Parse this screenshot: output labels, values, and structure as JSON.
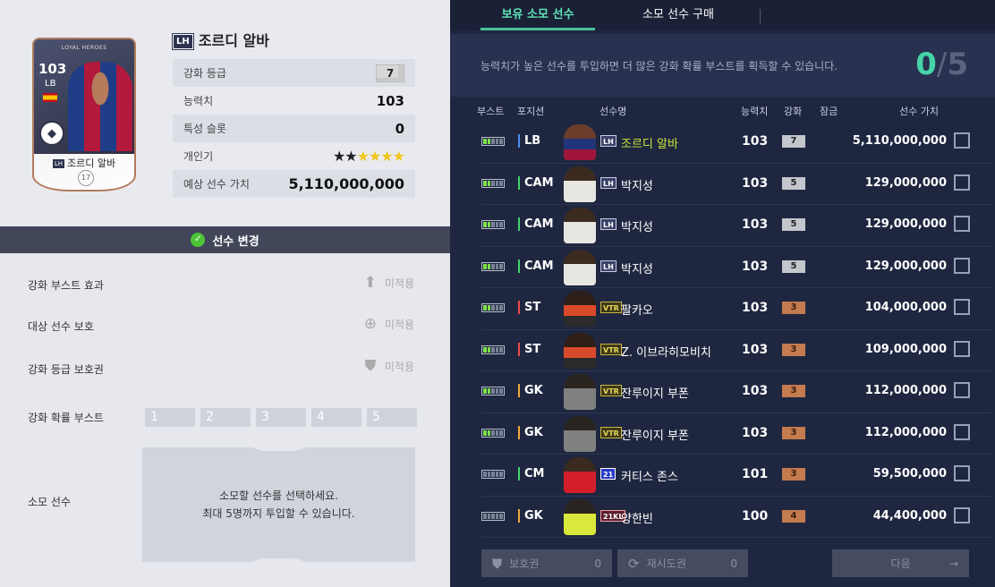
{
  "card": {
    "brand": "LOYAL HEROES",
    "ovr": "103",
    "pos": "LB",
    "season_tag": "LH",
    "name": "조르디 알바",
    "level": "7",
    "number": "17"
  },
  "player": {
    "season_tag": "LH",
    "name": "조르디 알바",
    "stats": [
      {
        "label": "강화 등급",
        "value": "7"
      },
      {
        "label": "능력치",
        "value": "103"
      },
      {
        "label": "특성 슬롯",
        "value": "0"
      },
      {
        "label": "개인기",
        "stars_filled": 2,
        "stars_total": 6
      },
      {
        "label": "예상 선수 가치",
        "value": "5,110,000,000"
      }
    ]
  },
  "change_player": {
    "label": "선수 변경"
  },
  "options": {
    "boost_effect": {
      "label": "강화 부스트 효과",
      "value": "미적용",
      "icon": "arrow-up-icon"
    },
    "protect": {
      "label": "대상 선수 보호",
      "value": "미적용",
      "icon": "plus-circle-icon"
    },
    "grade_protect": {
      "label": "강화 등급 보호권",
      "value": "미적용",
      "icon": "shield-icon"
    },
    "probability_boost": {
      "label": "강화 확률 부스트",
      "slots": [
        "1",
        "2",
        "3",
        "4",
        "5"
      ]
    },
    "sacrifice": {
      "label": "소모 선수",
      "line1": "소모할 선수를 선택하세요.",
      "line2": "최대 5명까지 투입할 수 있습니다."
    }
  },
  "tabs": [
    {
      "label": "보유 소모 선수",
      "active": true
    },
    {
      "label": "소모 선수 구매",
      "active": false
    }
  ],
  "info": {
    "text": "능력치가 높은 선수를 투입하면 더 많은 강화 확률 부스트를 획득할 수 있습니다.",
    "selected": "0",
    "max": "5"
  },
  "columns": {
    "boost": "부스트",
    "position": "포지션",
    "name": "선수명",
    "ovr": "능력치",
    "level": "강화",
    "locked": "잠금",
    "value": "선수 가치"
  },
  "rows": [
    {
      "pos": "LB",
      "season": "LH",
      "name": "조르디 알바",
      "ovr": "103",
      "level": "7",
      "price": "5,110,000,000",
      "boost": 2,
      "highlight": true,
      "posclass": "lb",
      "lvlclass": "silver",
      "seasclass": "lh"
    },
    {
      "pos": "CAM",
      "season": "LH",
      "name": "박지성",
      "ovr": "103",
      "level": "5",
      "price": "129,000,000",
      "boost": 2,
      "posclass": "mid",
      "lvlclass": "silver",
      "seasclass": "lh"
    },
    {
      "pos": "CAM",
      "season": "LH",
      "name": "박지성",
      "ovr": "103",
      "level": "5",
      "price": "129,000,000",
      "boost": 2,
      "posclass": "mid",
      "lvlclass": "silver",
      "seasclass": "lh"
    },
    {
      "pos": "CAM",
      "season": "LH",
      "name": "박지성",
      "ovr": "103",
      "level": "5",
      "price": "129,000,000",
      "boost": 2,
      "posclass": "mid",
      "lvlclass": "silver",
      "seasclass": "lh"
    },
    {
      "pos": "ST",
      "season": "VTR",
      "name": "팔카오",
      "ovr": "103",
      "level": "3",
      "price": "104,000,000",
      "boost": 2,
      "posclass": "fw",
      "lvlclass": "bronze",
      "seasclass": "vtr"
    },
    {
      "pos": "ST",
      "season": "VTR",
      "name": "Z. 이브라히모비치",
      "ovr": "103",
      "level": "3",
      "price": "109,000,000",
      "boost": 2,
      "posclass": "fw",
      "lvlclass": "bronze",
      "seasclass": "vtr"
    },
    {
      "pos": "GK",
      "season": "VTR",
      "name": "잔루이지 부폰",
      "ovr": "103",
      "level": "3",
      "price": "112,000,000",
      "boost": 2,
      "posclass": "gk",
      "lvlclass": "bronze",
      "seasclass": "vtr"
    },
    {
      "pos": "GK",
      "season": "VTR",
      "name": "잔루이지 부폰",
      "ovr": "103",
      "level": "3",
      "price": "112,000,000",
      "boost": 2,
      "posclass": "gk",
      "lvlclass": "bronze",
      "seasclass": "vtr"
    },
    {
      "pos": "CM",
      "season": "21",
      "name": "커티스 존스",
      "ovr": "101",
      "level": "3",
      "price": "59,500,000",
      "boost": 0,
      "posclass": "mid",
      "lvlclass": "bronze",
      "seasclass": "s21"
    },
    {
      "pos": "GK",
      "season": "21KL",
      "name": "양한빈",
      "ovr": "100",
      "level": "4",
      "price": "44,400,000",
      "boost": 0,
      "posclass": "gk",
      "lvlclass": "bronze",
      "seasclass": "s21kl"
    }
  ],
  "buttons": {
    "protect": {
      "label": "보호권",
      "count": "0",
      "icon": "shield-icon"
    },
    "retry": {
      "label": "재시도권",
      "count": "0",
      "icon": "refresh-icon"
    },
    "next": {
      "label": "다음",
      "icon": "arrow-right-icon"
    }
  },
  "colors": {
    "accent": "#46c19a",
    "highlight_name": "#c7e93b",
    "bg_dark": "#1f2740"
  }
}
